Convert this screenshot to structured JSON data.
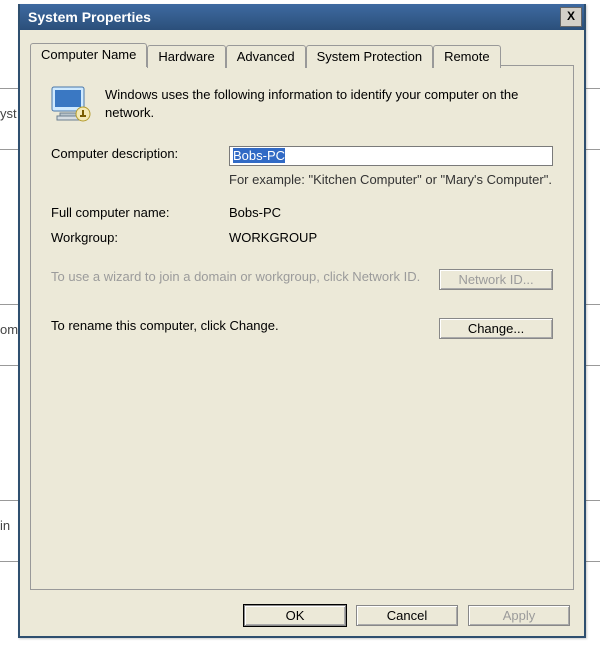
{
  "background_labels": {
    "syst": "yst",
    "com": "om",
    "win": "in"
  },
  "titlebar": {
    "title": "System Properties",
    "close": "X"
  },
  "tabs": {
    "t0": "Computer Name",
    "t1": "Hardware",
    "t2": "Advanced",
    "t3": "System Protection",
    "t4": "Remote"
  },
  "intro": "Windows uses the following information to identify your computer on the network.",
  "labels": {
    "desc": "Computer description:",
    "full": "Full computer name:",
    "wg": "Workgroup:"
  },
  "values": {
    "desc": "Bobs-PC",
    "desc_hint": "For example: \"Kitchen Computer\" or \"Mary's Computer\".",
    "full": "Bobs-PC",
    "wg": "WORKGROUP"
  },
  "wizard": {
    "text": "To use a wizard to join a domain or workgroup, click Network ID.",
    "btn": "Network ID..."
  },
  "rename": {
    "text": "To rename this computer, click Change.",
    "btn": "Change..."
  },
  "buttons": {
    "ok": "OK",
    "cancel": "Cancel",
    "apply": "Apply"
  }
}
